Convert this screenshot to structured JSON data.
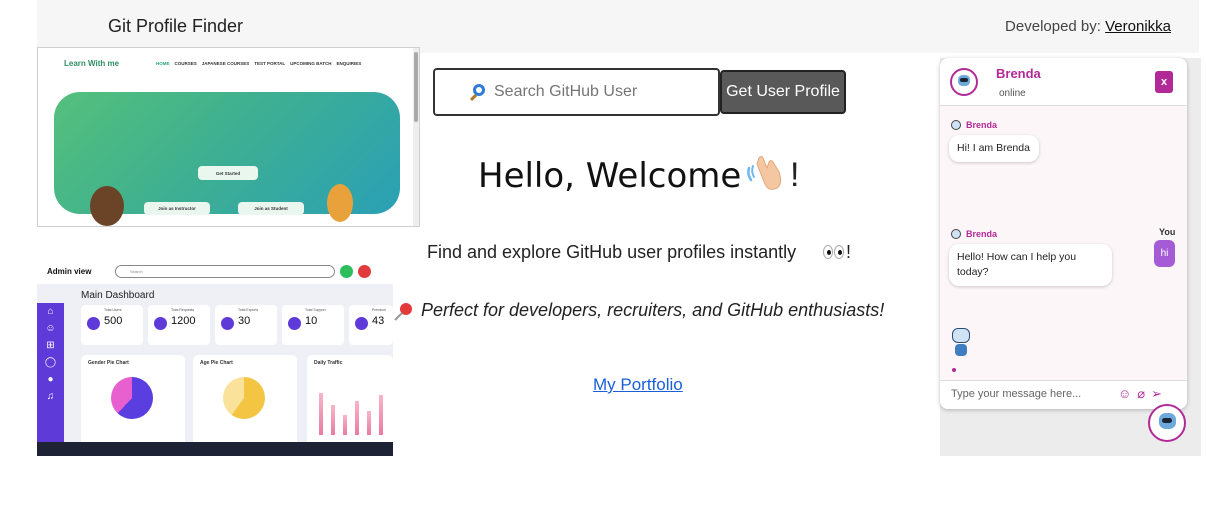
{
  "header": {
    "brand": "Git Profile Finder",
    "credit_prefix": "Developed by: ",
    "credit_link": "Veronikka"
  },
  "preview1": {
    "logo": "Learn With me",
    "nav": [
      "HOME",
      "COURSES",
      "JAPANESE COURSES",
      "TEST PORTAL",
      "UPCOMING BATCH",
      "ENQUIRIES"
    ],
    "get_started": "Get Started",
    "join_instructor": "Join as Instructor",
    "join_student": "Join as Student"
  },
  "preview2": {
    "title": "Admin view",
    "search_placeholder": "Search",
    "main": "Main Dashboard",
    "cards": [
      {
        "label": "Total Users",
        "value": "500"
      },
      {
        "label": "Total Requests",
        "value": "1200"
      },
      {
        "label": "Total Exports",
        "value": "30"
      },
      {
        "label": "Total Support",
        "value": "10"
      },
      {
        "label": "Premium",
        "value": "43"
      }
    ],
    "panels": [
      "Gender Pie Chart",
      "Age Pie Chart",
      "Daily Traffic"
    ]
  },
  "search": {
    "placeholder": "Search GitHub User",
    "button": "Get User Profile"
  },
  "hero": {
    "welcome": "Hello, Welcome",
    "exclaim": "!",
    "description": "Find and explore GitHub user profiles instantly",
    "description_end": "!",
    "perfect": "Perfect for developers, recruiters, and GitHub enthusiasts!",
    "portfolio": "My Portfolio"
  },
  "chat": {
    "name": "Brenda",
    "status": "online",
    "close": "x",
    "messages": [
      {
        "from": "Brenda",
        "text": "Hi! I am Brenda"
      },
      {
        "from": "You",
        "text": "hi"
      },
      {
        "from": "Brenda",
        "text": "Hello! How can I help you today?"
      }
    ],
    "input_placeholder": "Type your message here..."
  },
  "colors": {
    "accent": "#b12a97",
    "link": "#1a5fd8",
    "button": "#595959"
  }
}
